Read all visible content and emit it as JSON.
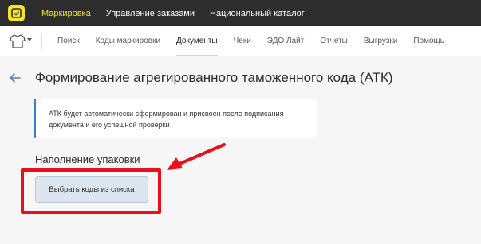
{
  "top_nav": {
    "items": [
      {
        "label": "Маркировка",
        "active": true
      },
      {
        "label": "Управление заказами",
        "active": false
      },
      {
        "label": "Национальный каталог",
        "active": false
      }
    ]
  },
  "sub_nav": {
    "category_icon": "tshirt-icon",
    "items": [
      {
        "label": "Поиск",
        "active": false
      },
      {
        "label": "Коды маркировки",
        "active": false
      },
      {
        "label": "Документы",
        "active": true
      },
      {
        "label": "Чеки",
        "active": false
      },
      {
        "label": "ЭДО Лайт",
        "active": false
      },
      {
        "label": "Отчеты",
        "active": false
      },
      {
        "label": "Выгрузки",
        "active": false
      },
      {
        "label": "Помощь",
        "active": false
      }
    ]
  },
  "page": {
    "title": "Формирование агрегированного таможенного кода (АТК)",
    "info_line1": "АТК будет автоматически сформирован и присвоен после подписания",
    "info_line2": "документа и его успешной проверки",
    "section_title": "Наполнение упаковки",
    "pick_button_label": "Выбрать коды из списка"
  },
  "colors": {
    "accent_yellow": "#f5e626",
    "topbar": "#2d2d2d",
    "info_border": "#3a7bd5",
    "annotation_red": "#e8101a"
  }
}
